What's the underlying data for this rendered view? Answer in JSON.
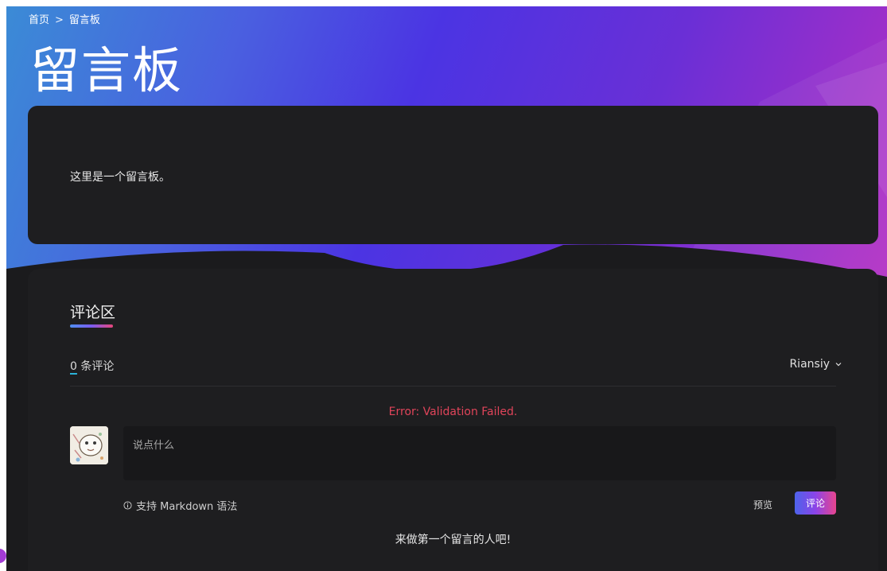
{
  "breadcrumb": {
    "home": "首页",
    "separator": ">",
    "current": "留言板"
  },
  "page": {
    "title": "留言板",
    "intro": "这里是一个留言板。"
  },
  "comments": {
    "section_title": "评论区",
    "count": "0",
    "count_label": "条评论",
    "sort_value": "Riansiy",
    "error": "Error: Validation Failed.",
    "placeholder": "说点什么",
    "markdown_hint": "支持 Markdown 语法",
    "preview_label": "预览",
    "submit_label": "评论",
    "empty": "来做第一个留言的人吧!"
  },
  "colors": {
    "hero_gradient": [
      "#3b8bd6",
      "#4b34e3",
      "#b32fc4"
    ],
    "error": "#e0445a",
    "card_bg": "#1e1e20"
  },
  "icons": [
    "info-icon",
    "chevron-down-icon"
  ]
}
